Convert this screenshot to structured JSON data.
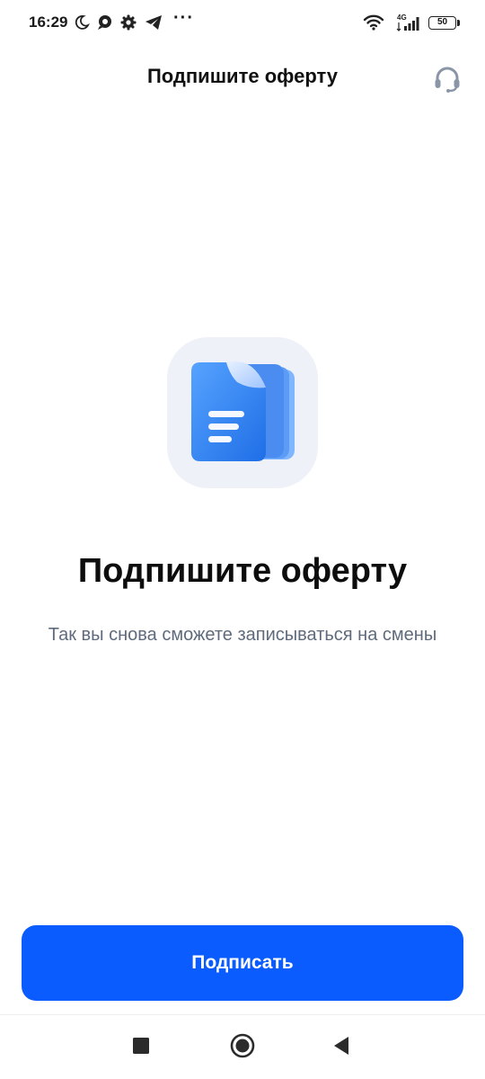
{
  "status_bar": {
    "time": "16:29",
    "network_type": "4G",
    "battery_level": "50",
    "icons": [
      "moon-icon",
      "chat-bubble-icon",
      "gear-icon",
      "telegram-icon",
      "more-dots-icon",
      "wifi-icon",
      "signal-icon",
      "battery-icon"
    ],
    "more_dots": "···"
  },
  "header": {
    "title": "Подпишите оферту",
    "support_icon": "headset-icon"
  },
  "illustration": {
    "icon": "document-stack-icon",
    "accent_color": "#3d8bf2"
  },
  "main": {
    "title": "Подпишите оферту",
    "subtitle": "Так вы снова сможете записываться на смены"
  },
  "actions": {
    "sign_label": "Подписать",
    "button_color": "#0a5cff"
  },
  "nav_bar": {
    "buttons": [
      "recents-square-icon",
      "home-circle-icon",
      "back-triangle-icon"
    ]
  }
}
